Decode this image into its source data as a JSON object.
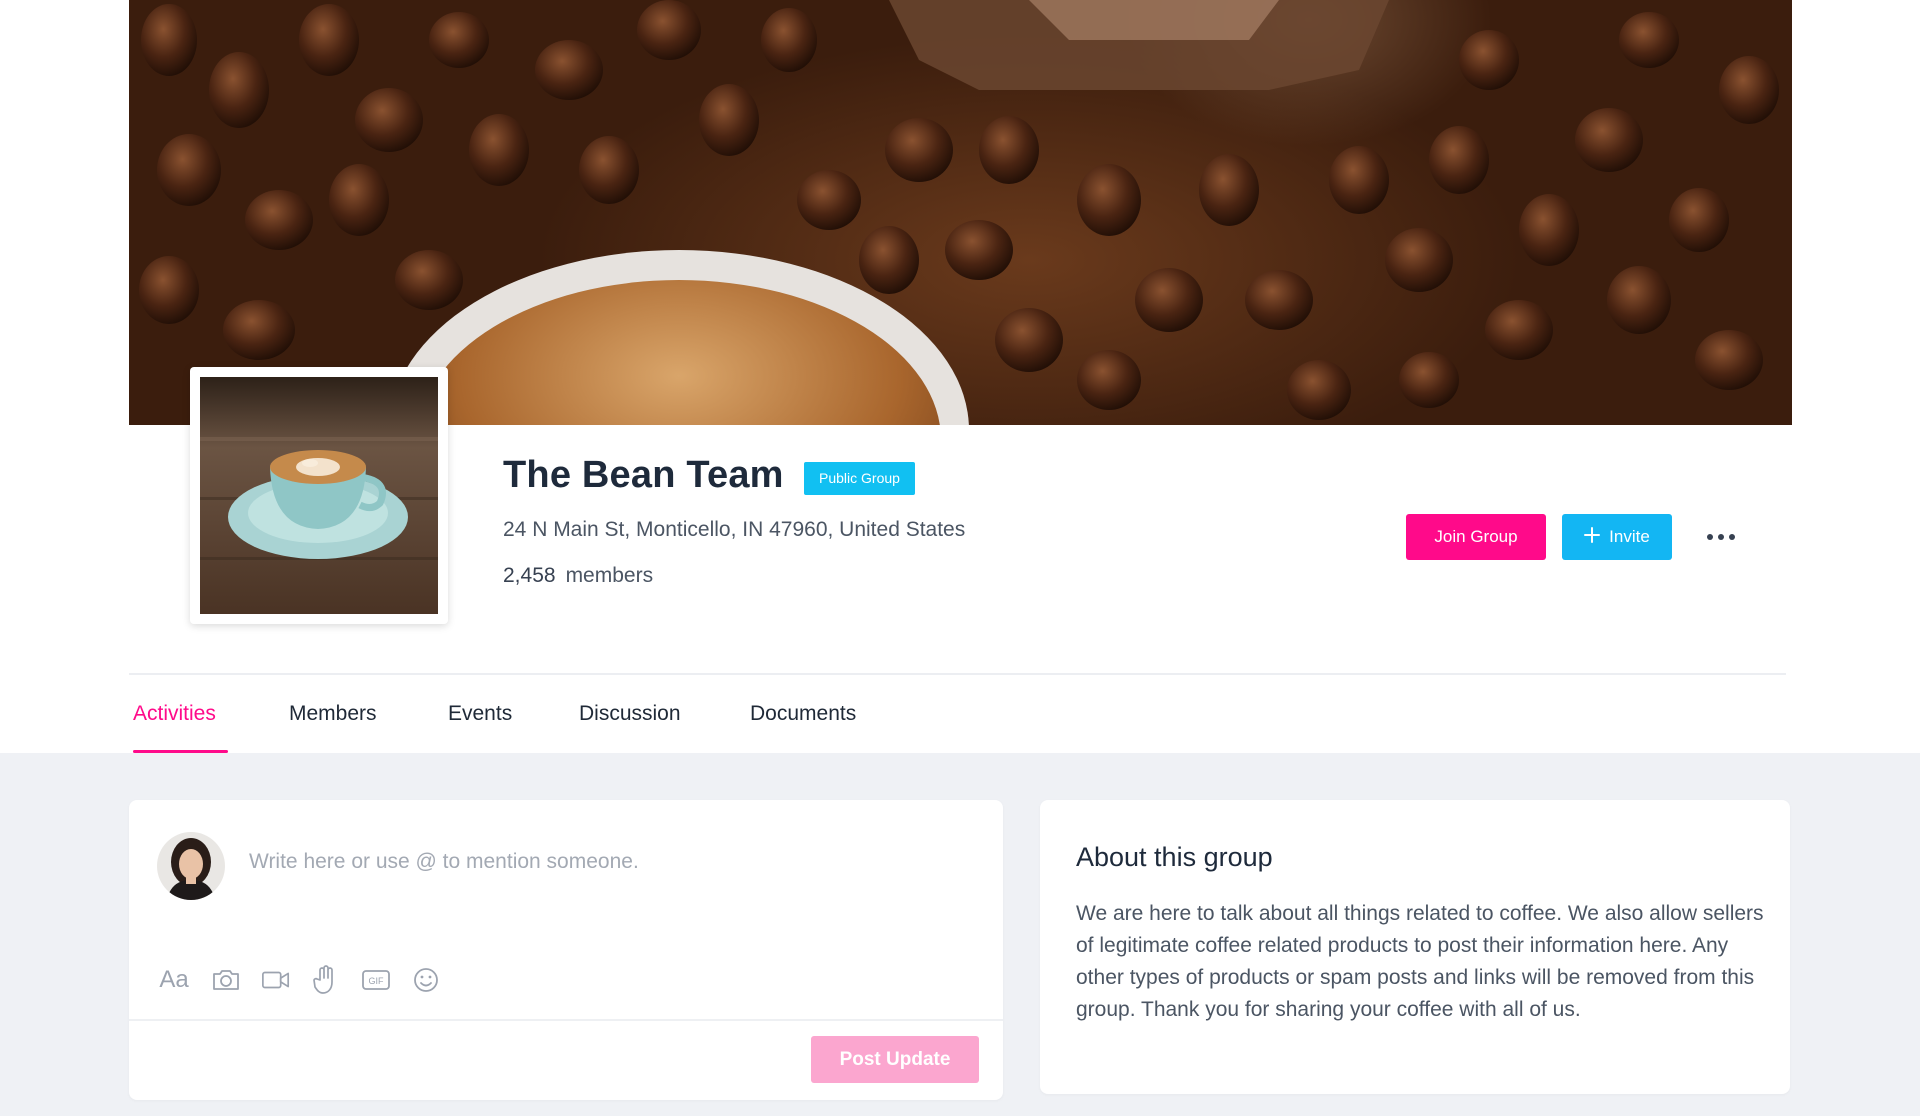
{
  "group": {
    "name": "The Bean Team",
    "badge": "Public Group",
    "address": "24 N Main St, Monticello, IN 47960, United States",
    "member_count": "2,458",
    "member_label": "members"
  },
  "actions": {
    "join_label": "Join Group",
    "invite_label": "Invite",
    "more_icon": "ellipsis-icon"
  },
  "tabs": [
    {
      "label": "Activities",
      "active": true
    },
    {
      "label": "Members",
      "active": false
    },
    {
      "label": "Events",
      "active": false
    },
    {
      "label": "Discussion",
      "active": false
    },
    {
      "label": "Documents",
      "active": false
    }
  ],
  "composer": {
    "placeholder": "Write here or use @ to mention someone.",
    "text_tool": "Aa",
    "tools": [
      "text-format-icon",
      "camera-icon",
      "video-icon",
      "hand-icon",
      "gif-icon",
      "emoji-icon"
    ],
    "post_label": "Post Update"
  },
  "about": {
    "title": "About this group",
    "text": "We are here to talk about all things related to coffee. We also allow sellers of legitimate coffee related products to post their information here. Any other types of products or spam posts and links will be removed from this group. Thank you for sharing your coffee with all of us."
  },
  "colors": {
    "accent_pink": "#ff0a8a",
    "accent_blue": "#13b6f3",
    "badge_blue": "#11c0f2",
    "post_disabled": "#fba6cf",
    "page_bg": "#eff1f5"
  }
}
